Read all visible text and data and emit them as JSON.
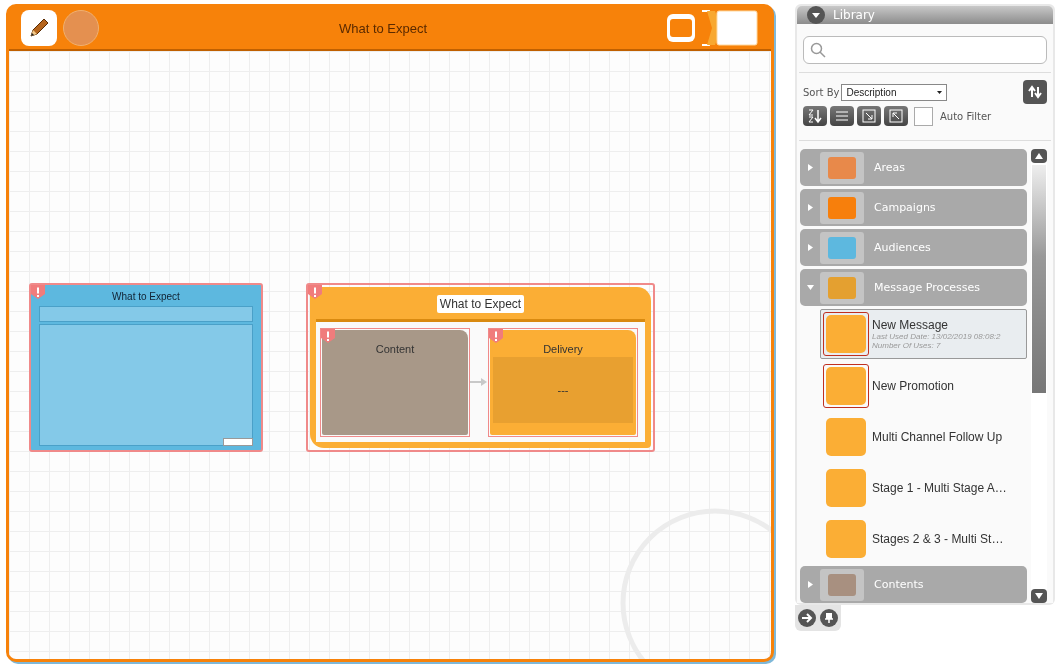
{
  "canvas": {
    "title": "What to Expect"
  },
  "nodes": [
    {
      "kind": "audience",
      "title": "What to Expect",
      "warning": true
    },
    {
      "kind": "process",
      "title": "What to Expect",
      "warning": true,
      "children": [
        {
          "kind": "content",
          "title": "Content",
          "warning": true
        },
        {
          "kind": "delivery",
          "title": "Delivery",
          "value": "---",
          "warning": true
        }
      ]
    }
  ],
  "library": {
    "title": "Library",
    "expanded": true,
    "sort_label": "Sort By",
    "sort_value": "Description",
    "auto_filter": {
      "label": "Auto Filter",
      "checked": false
    },
    "categories": [
      {
        "label": "Areas",
        "color": "#e8894a",
        "expanded": false
      },
      {
        "label": "Campaigns",
        "color": "#f77f0c",
        "expanded": false
      },
      {
        "label": "Audiences",
        "color": "#5db8df",
        "expanded": false
      },
      {
        "label": "Message Processes",
        "color": "#e4a030",
        "expanded": true,
        "items": [
          {
            "label": "New Message",
            "selected": true,
            "flagged": true,
            "details": [
              "Last Used Date: 13/02/2019 08:08:2",
              "Number Of Uses: 7"
            ]
          },
          {
            "label": "New Promotion",
            "selected": false,
            "flagged": true
          },
          {
            "label": "Multi Channel Follow Up",
            "selected": false,
            "flagged": false
          },
          {
            "label": "Stage 1 - Multi Stage A…",
            "selected": false,
            "flagged": false
          },
          {
            "label": "Stages 2 & 3 - Multi St…",
            "selected": false,
            "flagged": false
          }
        ]
      },
      {
        "label": "Contents",
        "color": "#a89080",
        "expanded": false
      }
    ]
  }
}
